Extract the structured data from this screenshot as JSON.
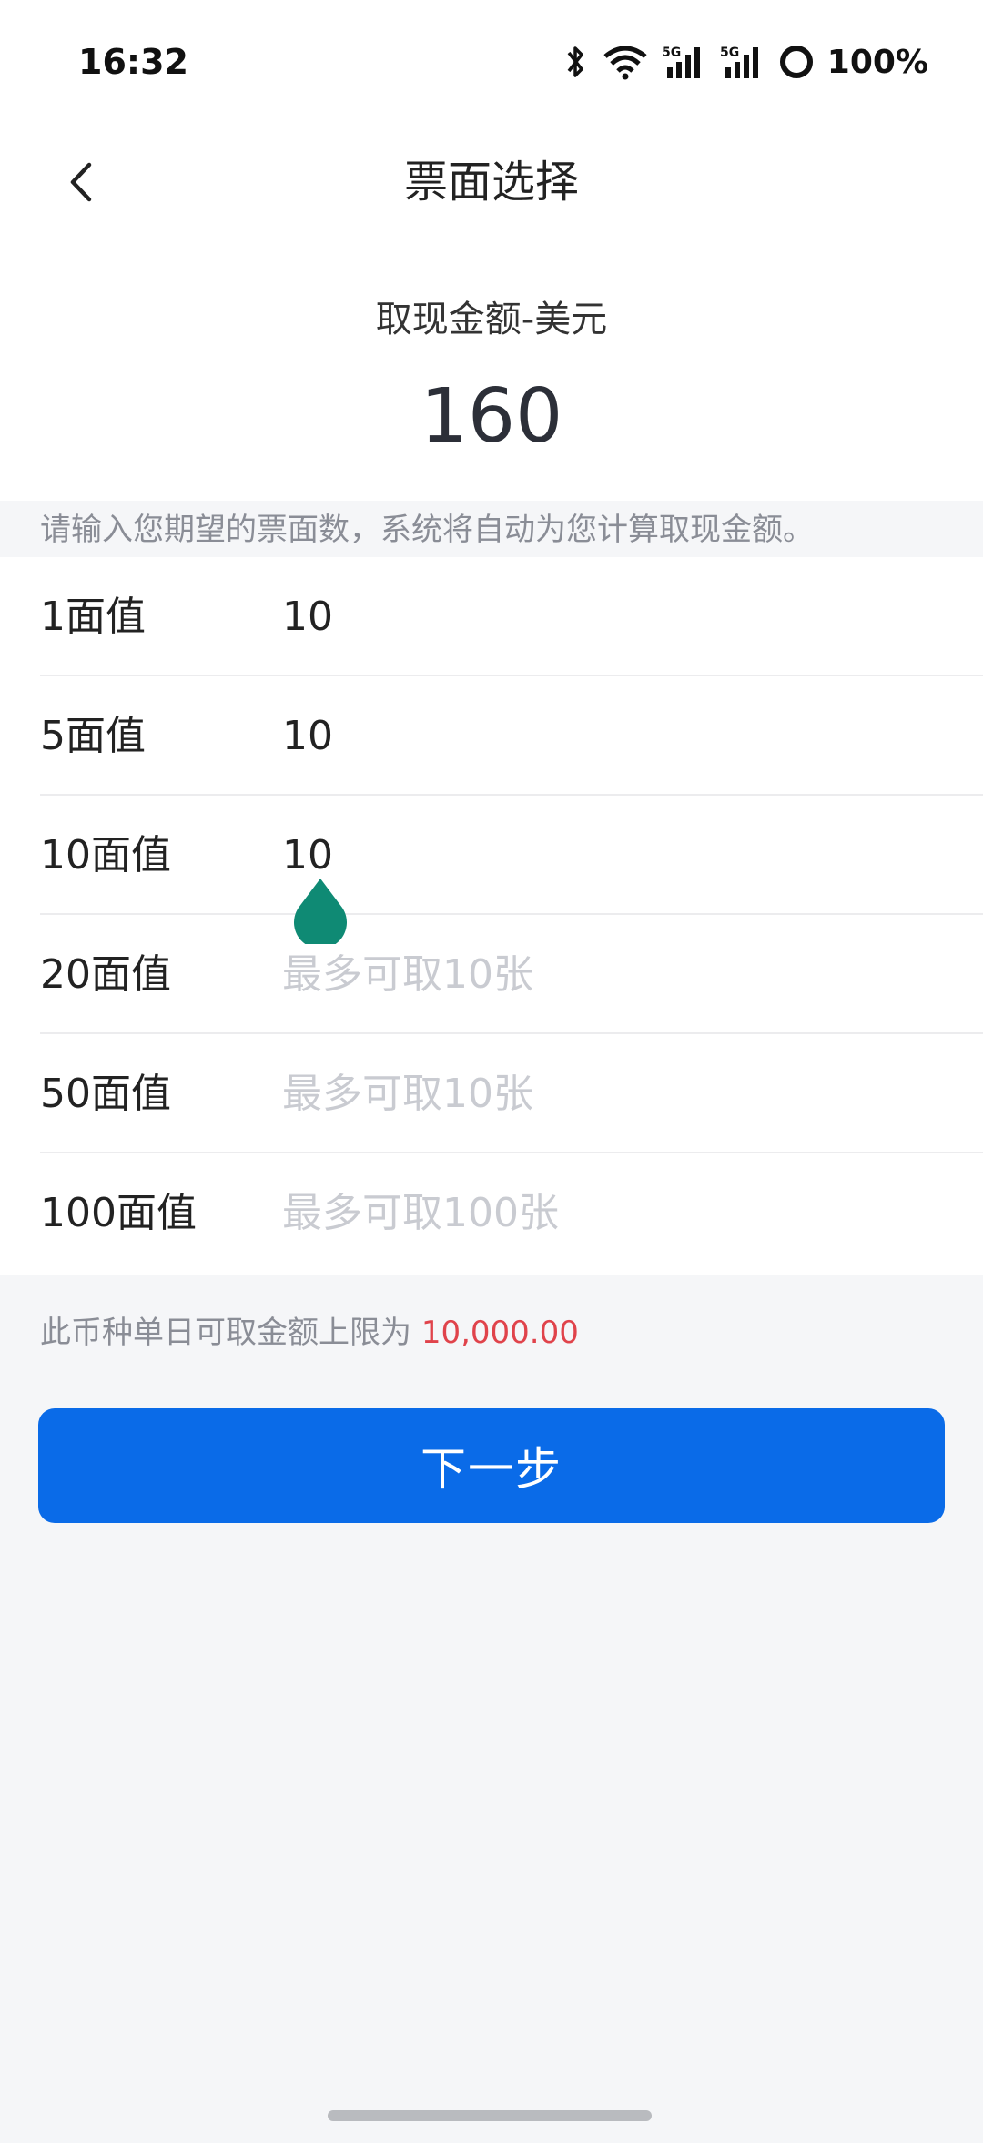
{
  "status_bar": {
    "time": "16:32",
    "battery": "100%",
    "network_a": "5G",
    "network_b": "5G"
  },
  "nav": {
    "title": "票面选择",
    "back_icon": "chevron-left-icon"
  },
  "amount": {
    "label": "取现金额-美元",
    "value": "160"
  },
  "hint": "请输入您期望的票面数，系统将自动为您计算取现金额。",
  "denominations": [
    {
      "label": "1面值",
      "value": "10",
      "placeholder": ""
    },
    {
      "label": "5面值",
      "value": "10",
      "placeholder": ""
    },
    {
      "label": "10面值",
      "value": "10",
      "placeholder": ""
    },
    {
      "label": "20面值",
      "value": "",
      "placeholder": "最多可取10张"
    },
    {
      "label": "50面值",
      "value": "",
      "placeholder": "最多可取10张"
    },
    {
      "label": "100面值",
      "value": "",
      "placeholder": "最多可取100张"
    }
  ],
  "limit": {
    "prefix": "此币种单日可取金额上限为 ",
    "amount": "10,000.00"
  },
  "next_button": {
    "label": "下一步"
  },
  "colors": {
    "primary": "#0a6be8",
    "limit_red": "#e0434b",
    "cursor_handle": "#0f8a74"
  }
}
